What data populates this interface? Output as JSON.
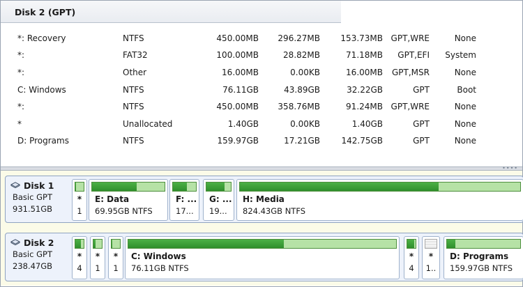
{
  "details": {
    "title": "Disk 2 (GPT)",
    "rows": [
      {
        "name": "*: Recovery",
        "fs": "NTFS",
        "capacity": "450.00MB",
        "used": "296.27MB",
        "free": "153.73MB",
        "flags": "GPT,WRE",
        "type": "None"
      },
      {
        "name": "*:",
        "fs": "FAT32",
        "capacity": "100.00MB",
        "used": "28.82MB",
        "free": "71.18MB",
        "flags": "GPT,EFI",
        "type": "System"
      },
      {
        "name": "*:",
        "fs": "Other",
        "capacity": "16.00MB",
        "used": "0.00KB",
        "free": "16.00MB",
        "flags": "GPT,MSR",
        "type": "None"
      },
      {
        "name": "C: Windows",
        "fs": "NTFS",
        "capacity": "76.11GB",
        "used": "43.89GB",
        "free": "32.22GB",
        "flags": "GPT",
        "type": "Boot"
      },
      {
        "name": "*:",
        "fs": "NTFS",
        "capacity": "450.00MB",
        "used": "358.76MB",
        "free": "91.24MB",
        "flags": "GPT,WRE",
        "type": "None"
      },
      {
        "name": "*",
        "fs": "Unallocated",
        "capacity": "1.40GB",
        "used": "0.00KB",
        "free": "1.40GB",
        "flags": "GPT",
        "type": "None"
      },
      {
        "name": "D: Programs",
        "fs": "NTFS",
        "capacity": "159.97GB",
        "used": "17.21GB",
        "free": "142.75GB",
        "flags": "GPT",
        "type": "None"
      }
    ]
  },
  "disks": [
    {
      "name": "Disk 1",
      "type": "Basic GPT",
      "size": "931.51GB",
      "partitions": [
        {
          "label": "*",
          "detail": "1",
          "usage": 0.1
        },
        {
          "label": "E: Data",
          "detail": "69.95GB NTFS",
          "usage": 0.62
        },
        {
          "label": "F: ...",
          "detail": "17...",
          "usage": 0.6
        },
        {
          "label": "G: ...",
          "detail": "19...",
          "usage": 0.75
        },
        {
          "label": "H: Media",
          "detail": "824.43GB NTFS",
          "usage": 0.71
        }
      ]
    },
    {
      "name": "Disk 2",
      "type": "Basic GPT",
      "size": "238.47GB",
      "partitions": [
        {
          "label": "*",
          "detail": "4",
          "usage": 0.66
        },
        {
          "label": "*",
          "detail": "1",
          "usage": 0.29
        },
        {
          "label": "*",
          "detail": "1",
          "usage": 0.1
        },
        {
          "label": "C: Windows",
          "detail": "76.11GB NTFS",
          "usage": 0.58
        },
        {
          "label": "*",
          "detail": "4",
          "usage": 0.8
        },
        {
          "label": "*",
          "detail": "1..",
          "usage": 0
        },
        {
          "label": "D: Programs",
          "detail": "159.97GB NTFS",
          "usage": 0.11
        }
      ]
    }
  ]
}
